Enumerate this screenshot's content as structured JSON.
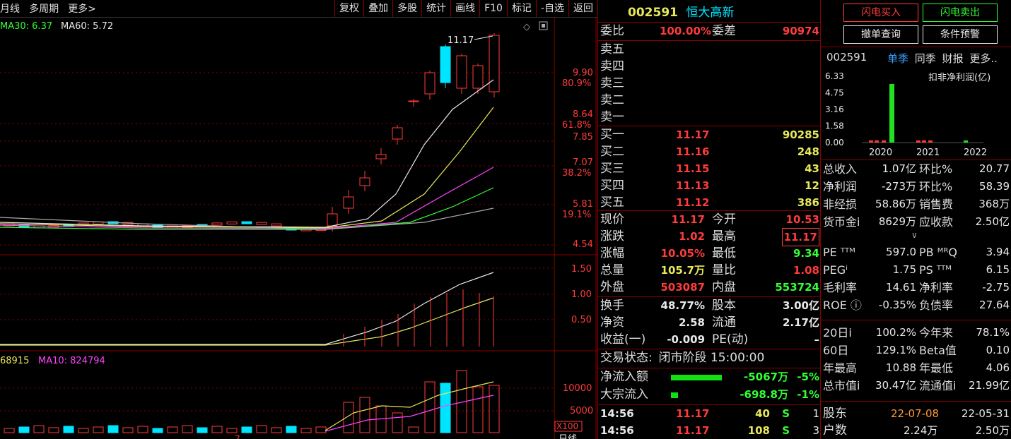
{
  "toolbar": {
    "left": [
      "月线",
      "多周期",
      "更多>"
    ],
    "right": [
      "复权",
      "叠加",
      "多股",
      "统计",
      "画线",
      "F10",
      "标记",
      "-自选",
      "返回"
    ]
  },
  "kline": {
    "ma_text": [
      {
        "label": "MA30: 6.37",
        "color": "#33ff33"
      },
      {
        "label": "MA60: 5.72",
        "color": "#e8e8e8"
      }
    ],
    "high_label": "11.17",
    "price_ticks": [
      {
        "price": "9.90",
        "pct": "80.9%"
      },
      {
        "price": "8.64",
        "pct": "61.8%"
      },
      {
        "price": "7.85",
        "pct": ""
      },
      {
        "price": "7.07",
        "pct": "38.2%"
      },
      {
        "price": "5.81",
        "pct": "19.1%"
      },
      {
        "price": "4.54",
        "pct": ""
      }
    ],
    "ind_ticks": [
      "1.50",
      "1.00",
      "0.50"
    ],
    "vol_text": [
      {
        "label": "68915",
        "color": "#e8e85a"
      },
      {
        "label": "MA10: 824794",
        "color": "#ff44ff"
      }
    ],
    "vol_ticks": [
      "10000",
      "5000"
    ],
    "vol_unit": "X100",
    "bottom_text": "日线",
    "bottom_mark": "7"
  },
  "stock": {
    "code": "002591",
    "name": "恒大高新"
  },
  "weibi": {
    "label1": "委比",
    "value1": "100.00%",
    "label2": "委差",
    "value2": "90974"
  },
  "asks": [
    "卖五",
    "卖四",
    "卖三",
    "卖二",
    "卖一"
  ],
  "bids": [
    {
      "label": "买一",
      "price": "11.17",
      "vol": "90285"
    },
    {
      "label": "买二",
      "price": "11.16",
      "vol": "248"
    },
    {
      "label": "买三",
      "price": "11.15",
      "vol": "43"
    },
    {
      "label": "买四",
      "price": "11.13",
      "vol": "12"
    },
    {
      "label": "买五",
      "price": "11.12",
      "vol": "386"
    }
  ],
  "quote": [
    {
      "l1": "现价",
      "v1": "11.17",
      "c1": "red",
      "l2": "今开",
      "v2": "10.53",
      "c2": "red"
    },
    {
      "l1": "涨跌",
      "v1": "1.02",
      "c1": "red",
      "l2": "最高",
      "v2": "11.17",
      "c2": "red"
    },
    {
      "l1": "涨幅",
      "v1": "10.05%",
      "c1": "red",
      "l2": "最低",
      "v2": "9.34",
      "c2": "grn"
    },
    {
      "l1": "总量",
      "v1": "105.7万",
      "c1": "yel",
      "l2": "量比",
      "v2": "1.08",
      "c2": "red"
    },
    {
      "l1": "外盘",
      "v1": "503087",
      "c1": "red",
      "l2": "内盘",
      "v2": "553724",
      "c2": "grn"
    }
  ],
  "quote2": [
    {
      "l1": "换手",
      "v1": "48.77%",
      "l2": "股本",
      "v2": "3.00亿"
    },
    {
      "l1": "净资",
      "v1": "2.58",
      "l2": "流通",
      "v2": "2.17亿"
    },
    {
      "l1": "收益(一)",
      "v1": "-0.009",
      "l2": "PE(动)",
      "v2": "–"
    }
  ],
  "trade_status": {
    "label": "交易状态:",
    "value": "闭市阶段 15:00:00"
  },
  "flows": [
    {
      "label": "净流入额",
      "value": "-5067万",
      "pct": "-5%",
      "bar_frac": 0.9
    },
    {
      "label": "大宗流入",
      "value": "-698.8万",
      "pct": "-1%",
      "bar_frac": 0.12
    }
  ],
  "ticks": [
    {
      "time": "14:56",
      "price": "11.17",
      "vol": "40",
      "side": "S",
      "n": "1"
    },
    {
      "time": "14:56",
      "price": "11.17",
      "vol": "108",
      "side": "S",
      "n": "3"
    }
  ],
  "buttons": {
    "flash_buy": "闪电买入",
    "flash_sell": "闪电卖出",
    "cancel_query": "撤单查询",
    "condition_alert": "条件预警"
  },
  "fin": {
    "code": "002591",
    "tabs": [
      "单季",
      "同季",
      "财报",
      "更多.."
    ],
    "title": "扣非净利润(亿)",
    "y_ticks": [
      "6.33",
      "4.75",
      "3.16",
      "1.58",
      "0.00"
    ],
    "x_labels": [
      "2020",
      "2021",
      "2022"
    ],
    "rows": [
      {
        "l1": "总收入",
        "v1": "1.07亿",
        "l2": "环比%",
        "v2": "20.77"
      },
      {
        "l1": "净利润",
        "v1": "-273万",
        "l2": "环比%",
        "v2": "58.39"
      },
      {
        "l1": "非经损",
        "v1": "58.86万",
        "l2": "销售费",
        "v2": "368万"
      },
      {
        "l1": "货币金i",
        "v1": "8629万",
        "l2": "应收款",
        "v2": "2.50亿"
      }
    ],
    "rows2": [
      {
        "l1": "PE ᵀᵀᴹ",
        "v1": "597.0",
        "l2": "PB ᴹᴿQ",
        "v2": "3.94"
      },
      {
        "l1": "PEGⁱ",
        "v1": "1.75",
        "l2": "PS ᵀᵀᴹ",
        "v2": "6.15"
      },
      {
        "l1": "毛利率",
        "v1": "14.61",
        "l2": "净利率",
        "v2": "-2.75"
      },
      {
        "l1": "ROE ⓘ",
        "v1": "-0.35%",
        "l2": "负债率",
        "v2": "27.64"
      }
    ],
    "rows3": [
      {
        "l1": "20日i",
        "v1": "100.2%",
        "l2": "今年来",
        "v2": "78.1%"
      },
      {
        "l1": "60日",
        "v1": "129.1%",
        "l2": "Beta值",
        "v2": "0.10"
      },
      {
        "l1": "年最高",
        "v1": "10.88",
        "l2": "年最低",
        "v2": "4.06"
      },
      {
        "l1": "总市值i",
        "v1": "30.47亿",
        "l2": "流通值i",
        "v2": "21.99亿"
      }
    ],
    "holders": {
      "l": "股东",
      "d1": "22-07-08",
      "d2": "22-05-31"
    },
    "households": {
      "l": "户数",
      "v1": "2.24万",
      "v2": "2.50万"
    }
  }
}
